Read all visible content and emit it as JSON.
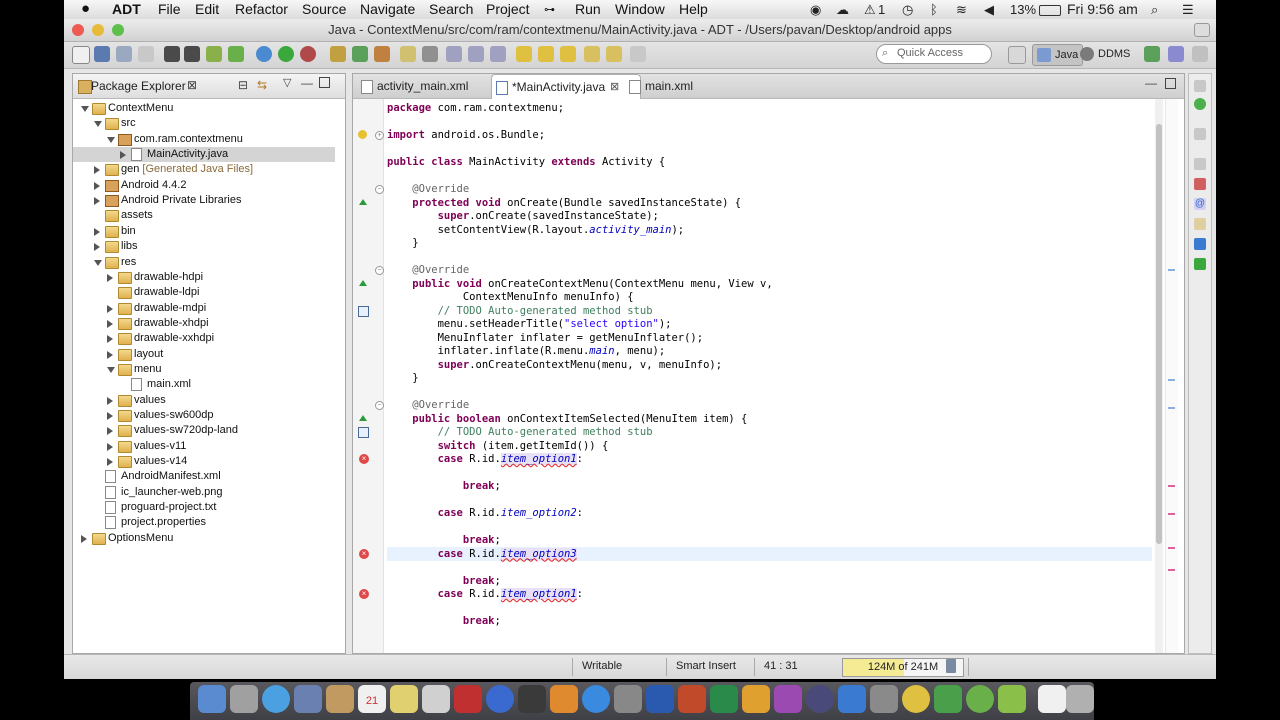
{
  "menubar": {
    "app": "ADT",
    "items": [
      "File",
      "Edit",
      "Refactor",
      "Source",
      "Navigate",
      "Search",
      "Project",
      "Run",
      "Window",
      "Help"
    ],
    "status": {
      "notify_count": "1",
      "battery": "13%",
      "clock": "Fri 9:56 am"
    }
  },
  "window": {
    "title": "Java - ContextMenu/src/com/ram/contextmenu/MainActivity.java - ADT - /Users/pavan/Desktop/android apps"
  },
  "toolbar": {
    "quick_access_placeholder": "Quick Access",
    "perspectives": [
      "Java",
      "DDMS"
    ]
  },
  "package_explorer": {
    "title": "Package Explorer",
    "tree": [
      {
        "label": "ContextMenu",
        "kind": "project",
        "expander": "open"
      },
      {
        "label": "src",
        "kind": "folder",
        "expander": "open"
      },
      {
        "label": "com.ram.contextmenu",
        "kind": "package",
        "expander": "open"
      },
      {
        "label": "MainActivity.java",
        "kind": "java",
        "expander": "closed",
        "selected": true
      },
      {
        "label": "gen",
        "suffix": "[Generated Java Files]",
        "kind": "folder",
        "expander": "closed"
      },
      {
        "label": "Android 4.4.2",
        "kind": "lib",
        "expander": "closed"
      },
      {
        "label": "Android Private Libraries",
        "kind": "lib",
        "expander": "closed"
      },
      {
        "label": "assets",
        "kind": "folder",
        "expander": "none"
      },
      {
        "label": "bin",
        "kind": "folder",
        "expander": "closed"
      },
      {
        "label": "libs",
        "kind": "folder",
        "expander": "closed"
      },
      {
        "label": "res",
        "kind": "folder",
        "expander": "open"
      },
      {
        "label": "drawable-hdpi",
        "kind": "folder",
        "expander": "closed"
      },
      {
        "label": "drawable-ldpi",
        "kind": "folder",
        "expander": "none"
      },
      {
        "label": "drawable-mdpi",
        "kind": "folder",
        "expander": "closed"
      },
      {
        "label": "drawable-xhdpi",
        "kind": "folder",
        "expander": "closed"
      },
      {
        "label": "drawable-xxhdpi",
        "kind": "folder",
        "expander": "closed"
      },
      {
        "label": "layout",
        "kind": "folder",
        "expander": "closed"
      },
      {
        "label": "menu",
        "kind": "folder",
        "expander": "open"
      },
      {
        "label": "main.xml",
        "kind": "xml",
        "expander": "none"
      },
      {
        "label": "values",
        "kind": "folder",
        "expander": "closed"
      },
      {
        "label": "values-sw600dp",
        "kind": "folder",
        "expander": "closed"
      },
      {
        "label": "values-sw720dp-land",
        "kind": "folder",
        "expander": "closed"
      },
      {
        "label": "values-v11",
        "kind": "folder",
        "expander": "closed"
      },
      {
        "label": "values-v14",
        "kind": "folder",
        "expander": "closed"
      },
      {
        "label": "AndroidManifest.xml",
        "kind": "xml",
        "expander": "none"
      },
      {
        "label": "ic_launcher-web.png",
        "kind": "image",
        "expander": "none"
      },
      {
        "label": "proguard-project.txt",
        "kind": "file",
        "expander": "none"
      },
      {
        "label": "project.properties",
        "kind": "file",
        "expander": "none"
      },
      {
        "label": "OptionsMenu",
        "kind": "project",
        "expander": "closed"
      }
    ]
  },
  "editor": {
    "tabs": [
      {
        "label": "activity_main.xml",
        "active": false
      },
      {
        "label": "*MainActivity.java",
        "active": true
      },
      {
        "label": "main.xml",
        "active": false
      }
    ],
    "lines": [
      [
        [
          "kw",
          "package"
        ],
        [
          "t",
          " com.ram.contextmenu;"
        ]
      ],
      [],
      [
        [
          "kw",
          "import"
        ],
        [
          "t",
          " android.os.Bundle;"
        ]
      ],
      [],
      [
        [
          "kw",
          "public class"
        ],
        [
          "t",
          " MainActivity "
        ],
        [
          "kw",
          "extends"
        ],
        [
          "t",
          " Activity {"
        ]
      ],
      [],
      [
        [
          "t",
          "    "
        ],
        [
          "ann",
          "@Override"
        ]
      ],
      [
        [
          "t",
          "    "
        ],
        [
          "kw",
          "protected void"
        ],
        [
          "t",
          " onCreate(Bundle savedInstanceState) {"
        ]
      ],
      [
        [
          "t",
          "        "
        ],
        [
          "kw",
          "super"
        ],
        [
          "t",
          ".onCreate(savedInstanceState);"
        ]
      ],
      [
        [
          "t",
          "        setContentView(R.layout."
        ],
        [
          "fld",
          "activity_main"
        ],
        [
          "t",
          ");"
        ]
      ],
      [
        [
          "t",
          "    }"
        ]
      ],
      [],
      [
        [
          "t",
          "    "
        ],
        [
          "ann",
          "@Override"
        ]
      ],
      [
        [
          "t",
          "    "
        ],
        [
          "kw",
          "public void"
        ],
        [
          "t",
          " onCreateContextMenu(ContextMenu menu, View v,"
        ]
      ],
      [
        [
          "t",
          "            ContextMenuInfo menuInfo) {"
        ]
      ],
      [
        [
          "t",
          "        "
        ],
        [
          "cm",
          "// TODO Auto-generated method stub"
        ]
      ],
      [
        [
          "t",
          "        menu.setHeaderTitle("
        ],
        [
          "str",
          "\"select option\""
        ],
        [
          "t",
          ");"
        ]
      ],
      [
        [
          "t",
          "        MenuInflater inflater = getMenuInflater();"
        ]
      ],
      [
        [
          "t",
          "        inflater.inflate(R.menu."
        ],
        [
          "fld",
          "main"
        ],
        [
          "t",
          ", menu);"
        ]
      ],
      [
        [
          "t",
          "        "
        ],
        [
          "kw",
          "super"
        ],
        [
          "t",
          ".onCreateContextMenu(menu, v, menuInfo);"
        ]
      ],
      [
        [
          "t",
          "    }"
        ]
      ],
      [],
      [
        [
          "t",
          "    "
        ],
        [
          "ann",
          "@Override"
        ]
      ],
      [
        [
          "t",
          "    "
        ],
        [
          "kw",
          "public boolean"
        ],
        [
          "t",
          " onContextItemSelected(MenuItem item) {"
        ]
      ],
      [
        [
          "t",
          "        "
        ],
        [
          "cm",
          "// TODO Auto-generated method stub"
        ]
      ],
      [
        [
          "t",
          "        "
        ],
        [
          "kw",
          "switch"
        ],
        [
          "t",
          " (item.getItemId()) {"
        ]
      ],
      [
        [
          "t",
          "        "
        ],
        [
          "kw",
          "case"
        ],
        [
          "t",
          " R.id."
        ],
        [
          "err",
          "item_option1"
        ],
        [
          "t",
          ":"
        ]
      ],
      [],
      [
        [
          "t",
          "            "
        ],
        [
          "kw",
          "break"
        ],
        [
          "t",
          ";"
        ]
      ],
      [],
      [
        [
          "t",
          "        "
        ],
        [
          "kw",
          "case"
        ],
        [
          "t",
          " R.id."
        ],
        [
          "fld",
          "item_option2"
        ],
        [
          "t",
          ":"
        ]
      ],
      [],
      [
        [
          "t",
          "            "
        ],
        [
          "kw",
          "break"
        ],
        [
          "t",
          ";"
        ]
      ],
      [
        [
          "t",
          "        "
        ],
        [
          "kw",
          "case"
        ],
        [
          "t",
          " R.id."
        ],
        [
          "err",
          "item_option3"
        ]
      ],
      [],
      [
        [
          "t",
          "            "
        ],
        [
          "kw",
          "break"
        ],
        [
          "t",
          ";"
        ]
      ],
      [
        [
          "t",
          "        "
        ],
        [
          "kw",
          "case"
        ],
        [
          "t",
          " R.id."
        ],
        [
          "err",
          "item_option1"
        ],
        [
          "t",
          ":"
        ]
      ],
      [],
      [
        [
          "t",
          "            "
        ],
        [
          "kw",
          "break"
        ],
        [
          "t",
          ";"
        ]
      ]
    ],
    "error_lines": [
      26,
      33,
      36
    ]
  },
  "statusbar": {
    "writable": "Writable",
    "insert_mode": "Smart Insert",
    "position": "41 : 31",
    "heap": "124M of 241M",
    "heap_fraction": 0.51
  }
}
